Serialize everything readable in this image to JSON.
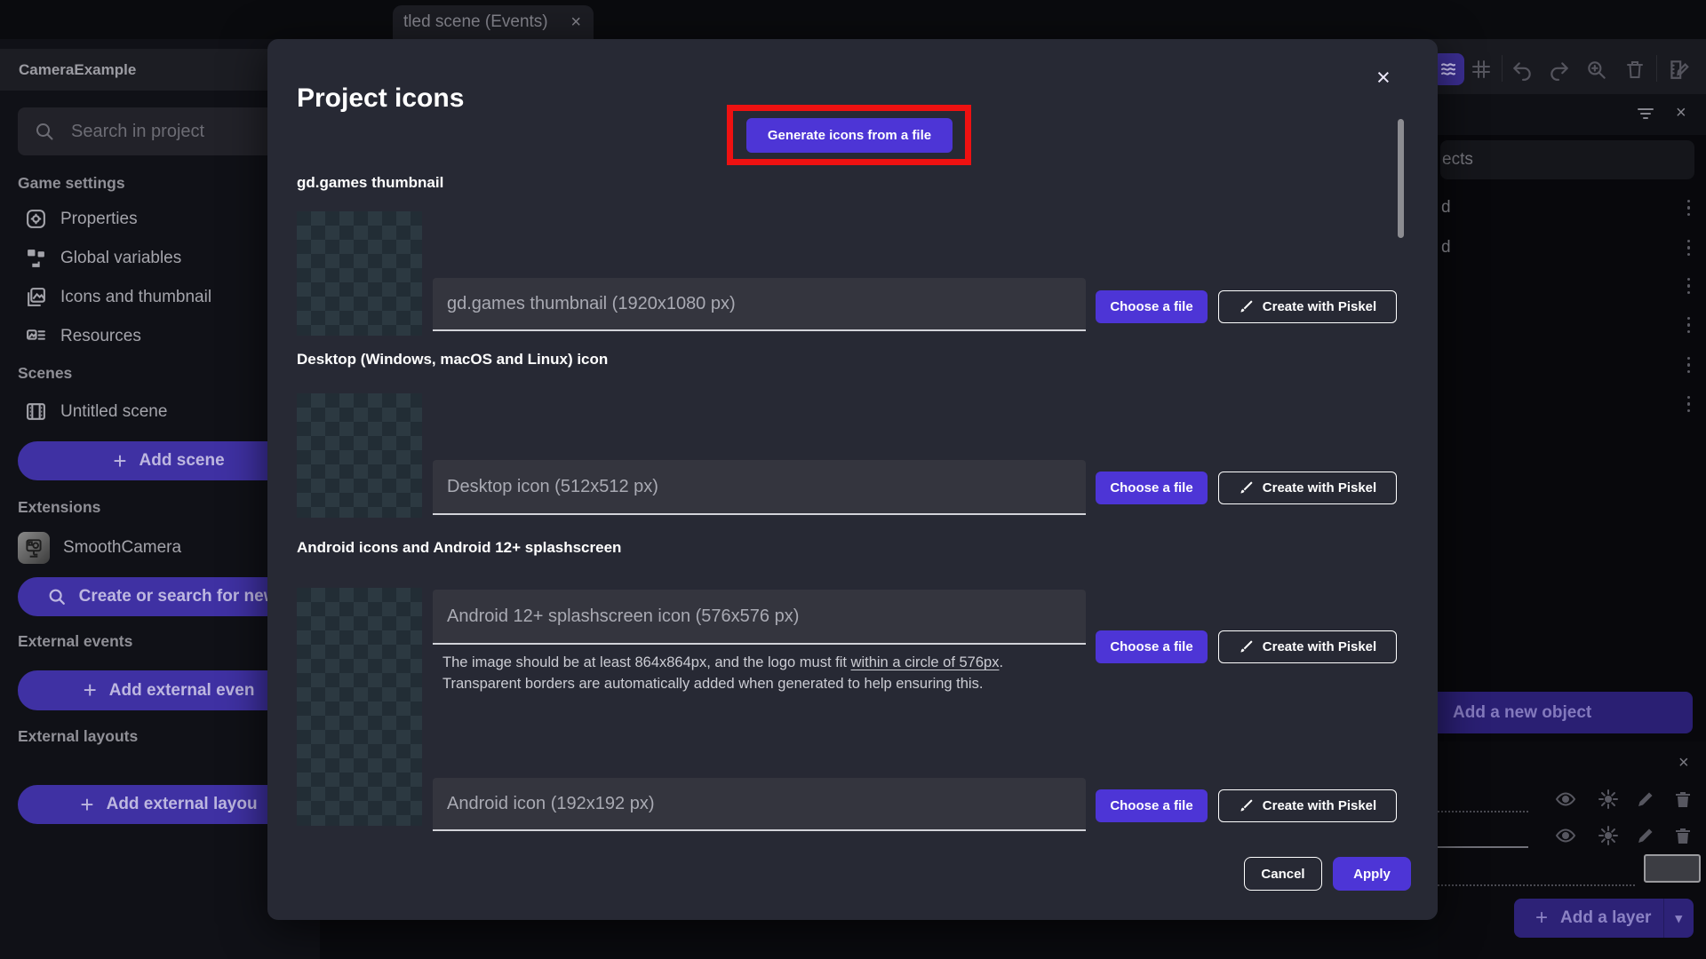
{
  "colors": {
    "accent_purple": "#4d35d6",
    "annotation_red": "#ee1111"
  },
  "tab": {
    "title": "tled scene (Events)",
    "close": "×"
  },
  "sidebar": {
    "project_name": "CameraExample",
    "search_placeholder": "Search in project",
    "game_settings_header": "Game settings",
    "items": [
      "Properties",
      "Global variables",
      "Icons and thumbnail",
      "Resources"
    ],
    "scenes_header": "Scenes",
    "scene_item": "Untitled scene",
    "add_scene": "Add scene",
    "extensions_header": "Extensions",
    "extension_item": "SmoothCamera",
    "search_extensions": "Create or search for new e",
    "external_events_header": "External events",
    "add_external_event": "Add external even",
    "external_layouts_header": "External layouts",
    "add_external_layout": "Add external layou"
  },
  "right_panel": {
    "search_visible_text": "ects",
    "rows": [
      {
        "label": "d"
      },
      {
        "label": "d"
      },
      {
        "label": ""
      },
      {
        "label": ""
      },
      {
        "label": ""
      },
      {
        "label": ""
      }
    ],
    "add_new_object": "Add a new object",
    "panel_close": "×",
    "add_layer": "Add a layer",
    "add_layer_caret": "▾"
  },
  "modal": {
    "title": "Project icons",
    "close": "×",
    "generate_button": "Generate icons from a file",
    "section1": "gd.games thumbnail",
    "row1_field": "gd.games thumbnail (1920x1080 px)",
    "section2": "Desktop (Windows, macOS and Linux) icon",
    "row2_field": "Desktop icon (512x512 px)",
    "section3": "Android icons and Android 12+ splashscreen",
    "row3_field": "Android 12+ splashscreen icon (576x576 px)",
    "row3_helper_pre": "The image should be at least 864x864px, and the logo must fit ",
    "row3_helper_link": "within a circle of 576px",
    "row3_helper_post": ".",
    "row3_helper2": "Transparent borders are automatically added when generated to help ensuring this.",
    "row4_field": "Android icon (192x192 px)",
    "choose_file": "Choose a file",
    "create_piskel": "Create with Piskel",
    "cancel": "Cancel",
    "apply": "Apply"
  }
}
